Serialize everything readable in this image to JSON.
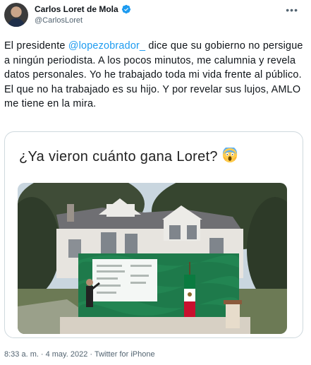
{
  "author": {
    "name": "Carlos Loret de Mola",
    "handle": "@CarlosLoret"
  },
  "tweet": {
    "prefix": "El presidente ",
    "mention": "@lopezobrador_",
    "body": " dice que su gobierno no persigue a ningún periodista. A los pocos minutos, me calumnia y revela datos personales. Yo he trabajado toda mi vida frente al público. El que no ha trabajado es su hijo. Y por revelar sus lujos, AMLO me tiene en la mira."
  },
  "media": {
    "title": "¿Ya vieron cuánto gana Loret?"
  },
  "footer": {
    "time": "8:33 a. m.",
    "date": "4 may. 2022",
    "source": "Twitter for iPhone",
    "separator": "·"
  },
  "colors": {
    "accent": "#1d9bf0",
    "text": "#0f1419",
    "muted": "#536471",
    "border": "#cfd9de",
    "stage_green": "#1e7a4b"
  }
}
